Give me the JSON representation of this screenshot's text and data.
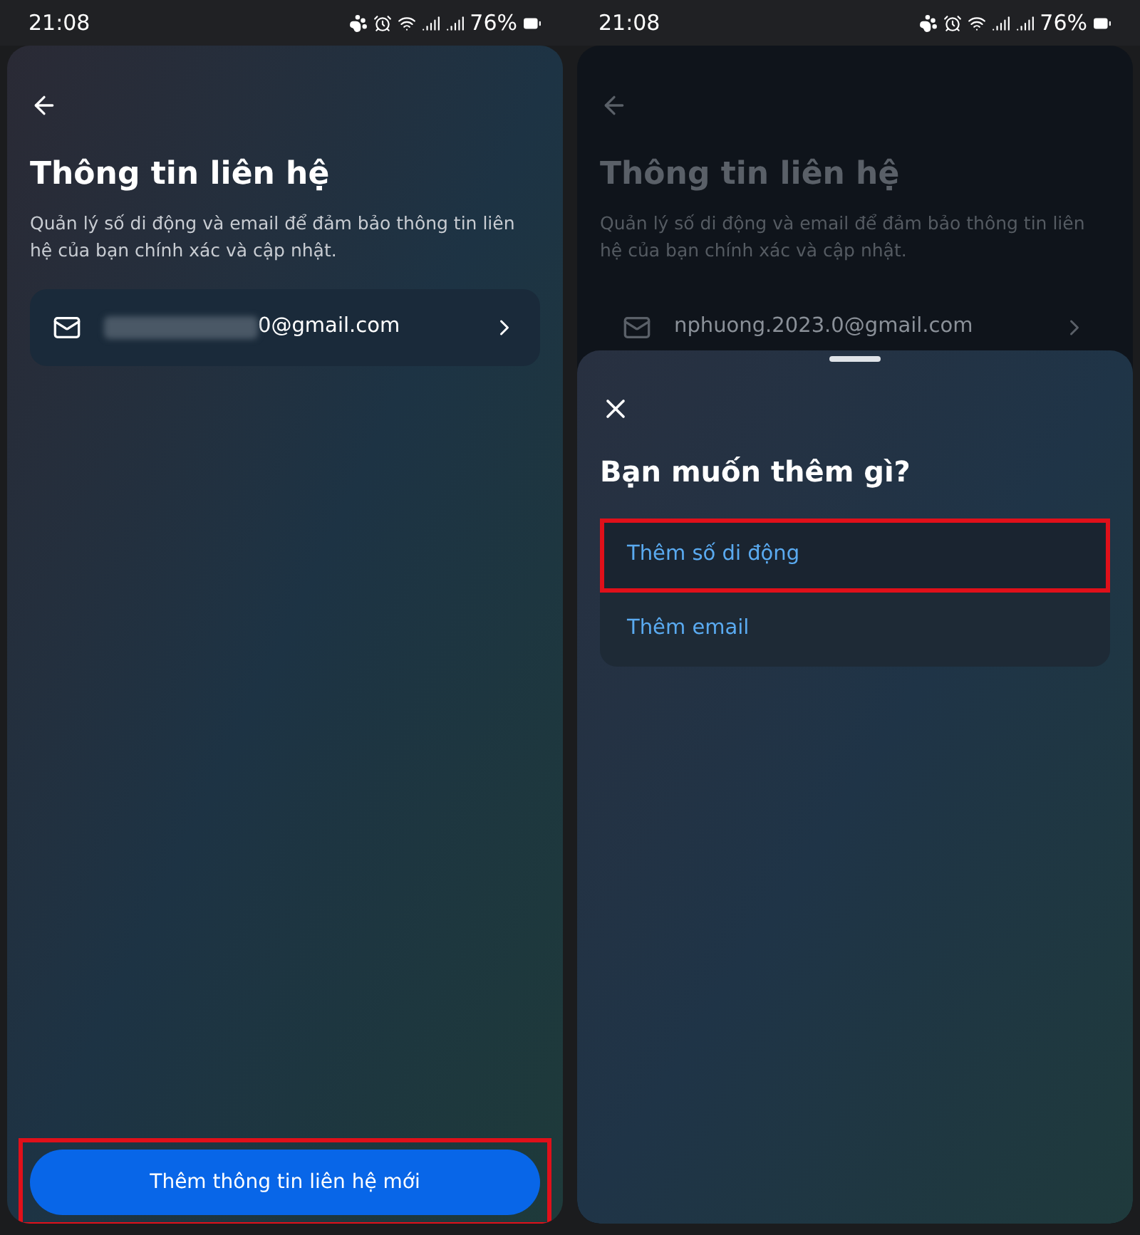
{
  "screens": [
    {
      "status_bar": {
        "time": "21:08",
        "battery": "76%"
      },
      "dimmed": false,
      "title": "Thông tin liên hệ",
      "description": "Quản lý số di động và email để đảm bảo thông tin liên hệ của bạn chính xác và cập nhật.",
      "contacts": [
        {
          "blurred": true,
          "email": "0@gmail.com"
        }
      ],
      "primary_button": {
        "label": "Thêm thông tin liên hệ mới",
        "highlighted": true
      }
    },
    {
      "status_bar": {
        "time": "21:08",
        "battery": "76%"
      },
      "dimmed": true,
      "title": "Thông tin liên hệ",
      "description": "Quản lý số di động và email để đảm bảo thông tin liên hệ của bạn chính xác và cập nhật.",
      "contacts": [
        {
          "blurred": false,
          "email": "nphuong.2023.0@gmail.com"
        }
      ],
      "sheet": {
        "title": "Bạn muốn thêm gì?",
        "options": [
          {
            "label": "Thêm số di động",
            "highlighted": true
          },
          {
            "label": "Thêm email",
            "highlighted": false
          }
        ]
      }
    }
  ]
}
